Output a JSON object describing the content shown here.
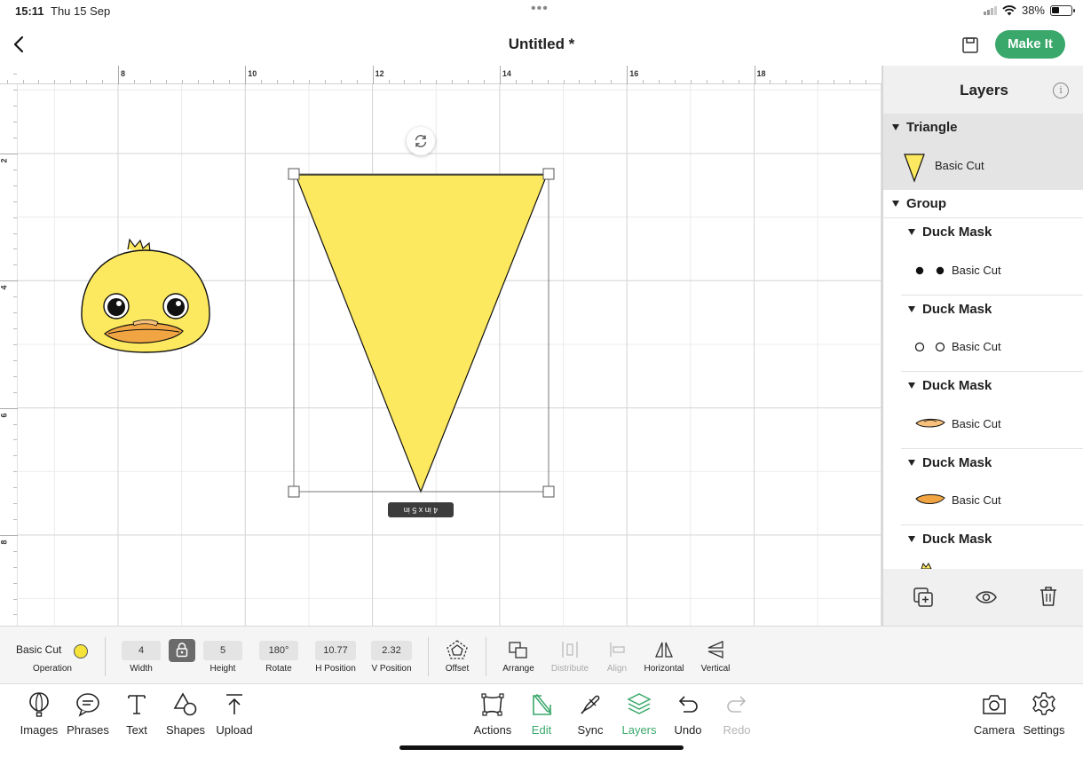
{
  "status": {
    "time": "15:11",
    "date": "Thu 15 Sep",
    "battery": "38%"
  },
  "header": {
    "title": "Untitled *",
    "make_it_label": "Make It"
  },
  "canvas": {
    "ruler_x_labels": [
      "8",
      "10",
      "12",
      "14",
      "16",
      "18"
    ],
    "ruler_y_labels": [
      "2",
      "4",
      "6",
      "8"
    ],
    "size_tag": "4 in x 5 in"
  },
  "layers": {
    "title": "Layers",
    "triangle": {
      "name": "Triangle",
      "op": "Basic Cut"
    },
    "group": {
      "name": "Group"
    },
    "duck_masks": [
      {
        "name": "Duck Mask",
        "op": "Basic Cut"
      },
      {
        "name": "Duck Mask",
        "op": "Basic Cut"
      },
      {
        "name": "Duck Mask",
        "op": "Basic Cut"
      },
      {
        "name": "Duck Mask",
        "op": "Basic Cut"
      },
      {
        "name": "Duck Mask"
      }
    ]
  },
  "edit_bar": {
    "operation_value": "Basic Cut",
    "operation_label": "Operation",
    "operation_color": "#f5e33a",
    "width_value": "4",
    "width_label": "Width",
    "height_value": "5",
    "height_label": "Height",
    "rotate_value": "180°",
    "rotate_label": "Rotate",
    "hpos_value": "10.77",
    "hpos_label": "H Position",
    "vpos_value": "2.32",
    "vpos_label": "V Position",
    "offset_label": "Offset",
    "arrange_label": "Arrange",
    "distribute_label": "Distribute",
    "align_label": "Align",
    "horizontal_label": "Horizontal",
    "vertical_label": "Vertical"
  },
  "bottom_bar": {
    "images": "Images",
    "phrases": "Phrases",
    "text": "Text",
    "shapes": "Shapes",
    "upload": "Upload",
    "actions": "Actions",
    "edit": "Edit",
    "sync": "Sync",
    "layers": "Layers",
    "undo": "Undo",
    "redo": "Redo",
    "camera": "Camera",
    "settings": "Settings"
  },
  "colors": {
    "accent": "#3aa86b",
    "triangle_fill": "#fde95f",
    "duck_face": "#fde95f",
    "beak": "#f1a542"
  }
}
